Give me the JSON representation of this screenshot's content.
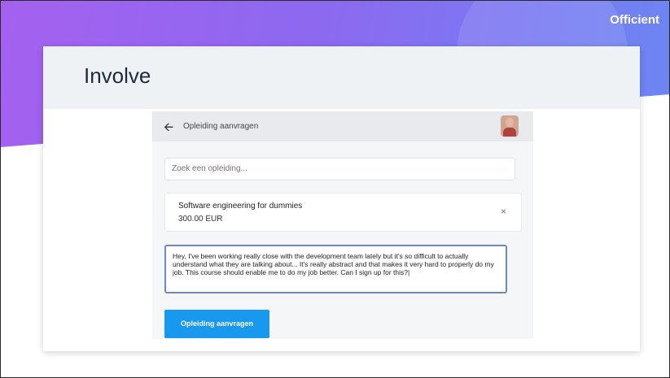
{
  "brand": {
    "name": "Officient"
  },
  "slide": {
    "title": "Involve"
  },
  "app": {
    "topbar": {
      "title": "Opleiding aanvragen",
      "back_icon": "arrow-left-icon"
    },
    "search": {
      "placeholder": "Zoek een opleiding..."
    },
    "selected_course": {
      "name": "Software engineering for dummies",
      "price": "300.00 EUR",
      "remove_icon": "close-icon"
    },
    "message": {
      "value": "Hey, I've been working really close with the development team lately but it's so difficult to actually understand what they are talking about... It's really abstract and that makes it very hard to properly do my job. This course should enable me to do my job better. Can I sign up for this?|"
    },
    "submit_label": "Opleiding aanvragen"
  },
  "colors": {
    "gradient_start": "#a461ef",
    "gradient_end": "#6c86f2",
    "primary_button": "#1998f0",
    "focus_border": "#6f86c8"
  }
}
